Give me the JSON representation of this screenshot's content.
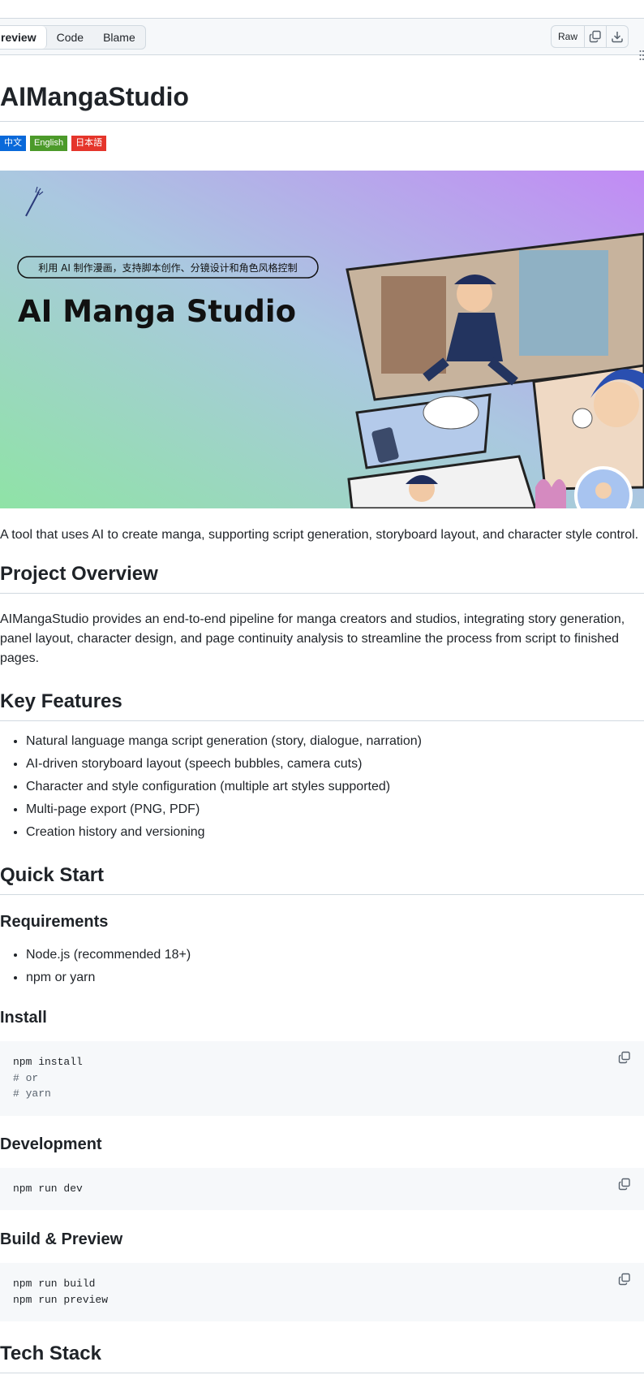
{
  "toolbar": {
    "tabs": [
      {
        "label": "review",
        "active": true
      },
      {
        "label": "Code",
        "active": false
      },
      {
        "label": "Blame",
        "active": false
      }
    ],
    "raw_label": "Raw",
    "icons": [
      "copy-icon",
      "download-icon",
      "list-icon"
    ]
  },
  "readme": {
    "title": "AIMangaStudio",
    "badges": [
      {
        "label": "中文",
        "color": "#0969da"
      },
      {
        "label": "English",
        "color": "#4c9a2a"
      },
      {
        "label": "日本語",
        "color": "#e5352b"
      }
    ],
    "hero": {
      "subtitle": "利用 AI 制作漫画，支持脚本创作、分镜设计和角色风格控制",
      "title": "AI Manga Studio"
    },
    "intro": "A tool that uses AI to create manga, supporting script generation, storyboard layout, and character style control.",
    "overview_heading": "Project Overview",
    "overview_text": "AIMangaStudio provides an end-to-end pipeline for manga creators and studios, integrating story generation, panel layout, character design, and page continuity analysis to streamline the process from script to finished pages.",
    "features_heading": "Key Features",
    "features": [
      "Natural language manga script generation (story, dialogue, narration)",
      "AI-driven storyboard layout (speech bubbles, camera cuts)",
      "Character and style configuration (multiple art styles supported)",
      "Multi-page export (PNG, PDF)",
      "Creation history and versioning"
    ],
    "quickstart_heading": "Quick Start",
    "requirements_heading": "Requirements",
    "requirements": [
      "Node.js (recommended 18+)",
      "npm or yarn"
    ],
    "install_heading": "Install",
    "install_code": {
      "line1": "npm install",
      "line2": "# or",
      "line3": "# yarn"
    },
    "dev_heading": "Development",
    "dev_code": "npm run dev",
    "build_heading": "Build & Preview",
    "build_code": {
      "line1": "npm run build",
      "line2": "npm run preview"
    },
    "techstack_heading": "Tech Stack"
  }
}
